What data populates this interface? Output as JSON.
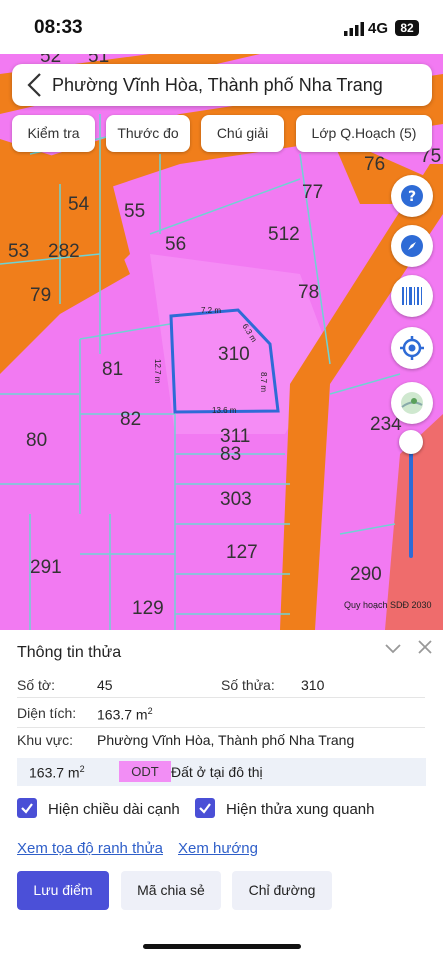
{
  "status_bar": {
    "time": "08:33",
    "network": "4G",
    "battery": "82"
  },
  "header": {
    "title": "Phường Vĩnh Hòa, Thành phố Nha Trang",
    "chips": [
      "Kiểm tra",
      "Thước đo",
      "Chú giải",
      "Lớp Q.Hoạch (5)"
    ]
  },
  "map": {
    "parcel_numbers": [
      "52",
      "51",
      "76",
      "75",
      "77",
      "54",
      "55",
      "53",
      "282",
      "56",
      "512",
      "79",
      "78",
      "310",
      "81",
      "82",
      "80",
      "311",
      "83",
      "303",
      "234",
      "127",
      "291",
      "290",
      "129"
    ],
    "edges": [
      "7.2 m",
      "6.3 m",
      "12.7 m",
      "8.7 m",
      "13.6 m"
    ],
    "caption": "Quy hoạch SDĐ 2030",
    "colors": {
      "land": "#f27af2",
      "road": "#f07e1b",
      "grid": "#6fd3d3",
      "selected": "#2e6bd6"
    }
  },
  "panel": {
    "title": "Thông tin thửa",
    "so_to_label": "Số tờ:",
    "so_to": "45",
    "so_thua_label": "Số thửa:",
    "so_thua": "310",
    "dien_tich_label": "Diện tích:",
    "dien_tich": "163.7 m",
    "dien_tich_sup": "2",
    "khu_vuc_label": "Khu vực:",
    "khu_vuc": "Phường Vĩnh Hòa, Thành phố Nha Trang",
    "zone_area": "163.7 m",
    "zone_area_sup": "2",
    "zone_code": "ODT",
    "zone_desc": "Đất ở tại đô thị",
    "checkbox_1": "Hiện chiều dài cạnh",
    "checkbox_2": "Hiện thửa xung quanh",
    "link_1": "Xem tọa độ ranh thửa",
    "link_2": "Xem hướng",
    "btn_save": "Lưu điểm",
    "btn_share": "Mã chia sẻ",
    "btn_route": "Chỉ đường"
  }
}
